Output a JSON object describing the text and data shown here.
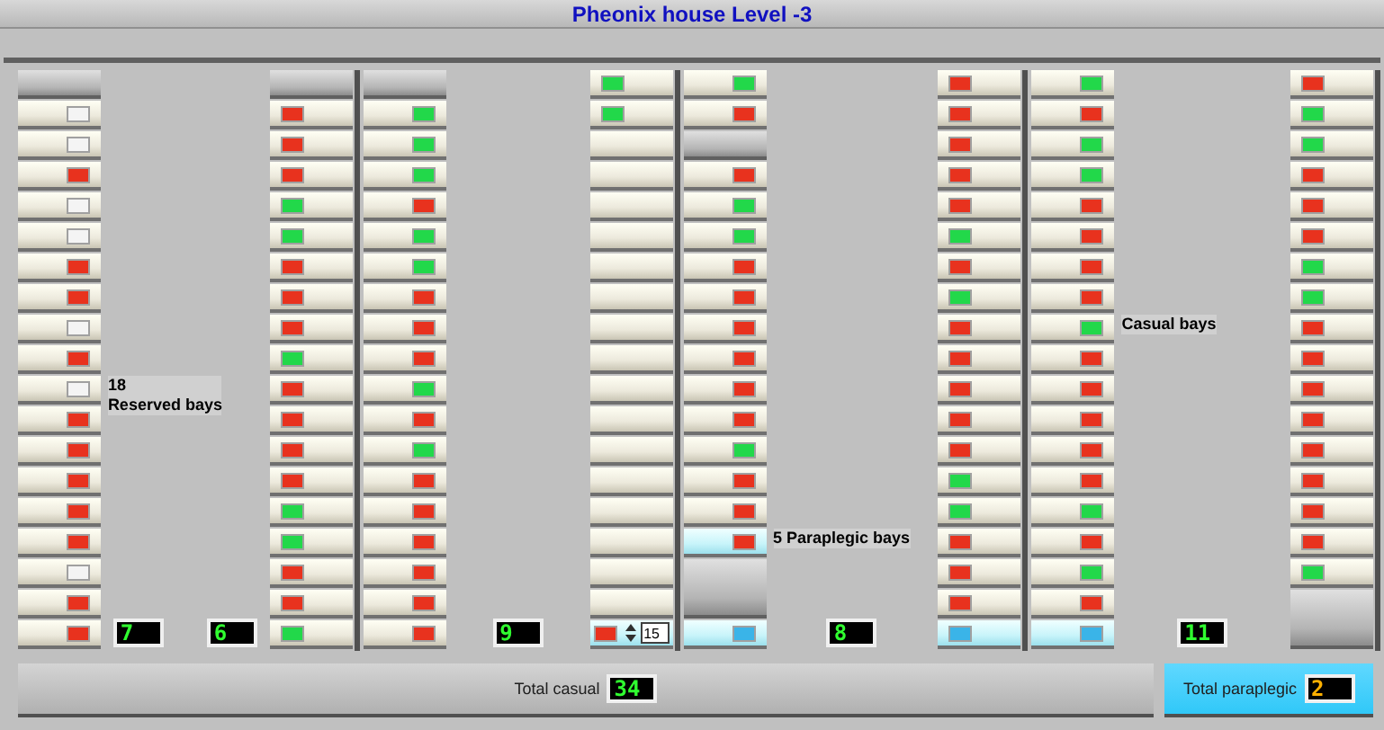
{
  "window": {
    "title": "Pheonix house Level -3"
  },
  "sections": [
    {
      "kind": "lane",
      "bays": [
        {
          "kind": "header"
        },
        {
          "kind": "bay",
          "color": "#f4f4f4"
        },
        {
          "kind": "bay",
          "color": "#f4f4f4"
        },
        {
          "kind": "bay",
          "color": "#e8321e"
        },
        {
          "kind": "bay",
          "color": "#f4f4f4"
        },
        {
          "kind": "bay",
          "color": "#f4f4f4"
        },
        {
          "kind": "bay",
          "color": "#e8321e"
        },
        {
          "kind": "bay",
          "color": "#e8321e"
        },
        {
          "kind": "bay",
          "color": "#f4f4f4"
        },
        {
          "kind": "bay",
          "color": "#e8321e"
        },
        {
          "kind": "bay",
          "color": "#f4f4f4",
          "note": [
            "18",
            "Reserved bays"
          ]
        },
        {
          "kind": "bay",
          "color": "#e8321e"
        },
        {
          "kind": "bay",
          "color": "#e8321e"
        },
        {
          "kind": "bay",
          "color": "#e8321e"
        },
        {
          "kind": "bay",
          "color": "#e8321e"
        },
        {
          "kind": "bay",
          "color": "#e8321e"
        },
        {
          "kind": "bay",
          "color": "#f4f4f4"
        },
        {
          "kind": "bay",
          "color": "#e8321e"
        },
        {
          "kind": "bay",
          "color": "#e8321e"
        }
      ]
    },
    {
      "kind": "gap",
      "counters": [
        "7",
        "6"
      ]
    },
    {
      "kind": "lane",
      "bays": [
        {
          "kind": "header"
        },
        {
          "kind": "bay",
          "color": "#e8321e"
        },
        {
          "kind": "bay",
          "color": "#e8321e"
        },
        {
          "kind": "bay",
          "color": "#e8321e"
        },
        {
          "kind": "bay",
          "color": "#22d84a"
        },
        {
          "kind": "bay",
          "color": "#22d84a"
        },
        {
          "kind": "bay",
          "color": "#e8321e"
        },
        {
          "kind": "bay",
          "color": "#e8321e"
        },
        {
          "kind": "bay",
          "color": "#e8321e"
        },
        {
          "kind": "bay",
          "color": "#22d84a"
        },
        {
          "kind": "bay",
          "color": "#e8321e"
        },
        {
          "kind": "bay",
          "color": "#e8321e"
        },
        {
          "kind": "bay",
          "color": "#e8321e"
        },
        {
          "kind": "bay",
          "color": "#e8321e"
        },
        {
          "kind": "bay",
          "color": "#22d84a"
        },
        {
          "kind": "bay",
          "color": "#22d84a"
        },
        {
          "kind": "bay",
          "color": "#e8321e"
        },
        {
          "kind": "bay",
          "color": "#e8321e"
        },
        {
          "kind": "bay",
          "color": "#22d84a"
        }
      ]
    },
    {
      "kind": "divider"
    },
    {
      "kind": "lane",
      "bays": [
        {
          "kind": "header"
        },
        {
          "kind": "bay",
          "color": "#22d84a"
        },
        {
          "kind": "bay",
          "color": "#22d84a"
        },
        {
          "kind": "bay",
          "color": "#22d84a"
        },
        {
          "kind": "bay",
          "color": "#e8321e"
        },
        {
          "kind": "bay",
          "color": "#22d84a"
        },
        {
          "kind": "bay",
          "color": "#22d84a"
        },
        {
          "kind": "bay",
          "color": "#e8321e"
        },
        {
          "kind": "bay",
          "color": "#e8321e"
        },
        {
          "kind": "bay",
          "color": "#e8321e"
        },
        {
          "kind": "bay",
          "color": "#22d84a"
        },
        {
          "kind": "bay",
          "color": "#e8321e"
        },
        {
          "kind": "bay",
          "color": "#22d84a"
        },
        {
          "kind": "bay",
          "color": "#e8321e"
        },
        {
          "kind": "bay",
          "color": "#e8321e"
        },
        {
          "kind": "bay",
          "color": "#e8321e"
        },
        {
          "kind": "bay",
          "color": "#e8321e"
        },
        {
          "kind": "bay",
          "color": "#e8321e"
        },
        {
          "kind": "bay",
          "color": "#e8321e"
        }
      ]
    },
    {
      "kind": "gap",
      "counters": [
        "9"
      ]
    },
    {
      "kind": "lane",
      "bays": [
        {
          "kind": "bay",
          "color": "#22d84a"
        },
        {
          "kind": "bay",
          "color": "#22d84a"
        },
        {
          "kind": "bay"
        },
        {
          "kind": "bay"
        },
        {
          "kind": "bay"
        },
        {
          "kind": "bay"
        },
        {
          "kind": "bay"
        },
        {
          "kind": "bay"
        },
        {
          "kind": "bay"
        },
        {
          "kind": "bay"
        },
        {
          "kind": "bay"
        },
        {
          "kind": "bay"
        },
        {
          "kind": "bay"
        },
        {
          "kind": "bay"
        },
        {
          "kind": "bay"
        },
        {
          "kind": "bay"
        },
        {
          "kind": "bay"
        },
        {
          "kind": "bay"
        },
        {
          "kind": "spinner",
          "color": "#e8321e",
          "value": "15",
          "accessible": true
        }
      ]
    },
    {
      "kind": "divider"
    },
    {
      "kind": "lane",
      "bays": [
        {
          "kind": "bay",
          "color": "#22d84a"
        },
        {
          "kind": "bay",
          "color": "#e8321e"
        },
        {
          "kind": "header"
        },
        {
          "kind": "bay",
          "color": "#e8321e"
        },
        {
          "kind": "bay",
          "color": "#22d84a"
        },
        {
          "kind": "bay",
          "color": "#22d84a"
        },
        {
          "kind": "bay",
          "color": "#e8321e"
        },
        {
          "kind": "bay",
          "color": "#e8321e"
        },
        {
          "kind": "bay",
          "color": "#e8321e"
        },
        {
          "kind": "bay",
          "color": "#e8321e"
        },
        {
          "kind": "bay",
          "color": "#e8321e"
        },
        {
          "kind": "bay",
          "color": "#e8321e"
        },
        {
          "kind": "bay",
          "color": "#22d84a"
        },
        {
          "kind": "bay",
          "color": "#e8321e"
        },
        {
          "kind": "bay",
          "color": "#e8321e"
        },
        {
          "kind": "bay",
          "color": "#e8321e",
          "accessible": true,
          "note": [
            "5 Paraplegic bays"
          ]
        },
        {
          "kind": "double"
        },
        {
          "kind": "bay",
          "color": "#3ab4e8",
          "accessible": true
        }
      ]
    },
    {
      "kind": "gap",
      "counters": [
        "8"
      ]
    },
    {
      "kind": "lane",
      "bays": [
        {
          "kind": "bay",
          "color": "#e8321e"
        },
        {
          "kind": "bay",
          "color": "#e8321e"
        },
        {
          "kind": "bay",
          "color": "#e8321e"
        },
        {
          "kind": "bay",
          "color": "#e8321e"
        },
        {
          "kind": "bay",
          "color": "#e8321e"
        },
        {
          "kind": "bay",
          "color": "#22d84a"
        },
        {
          "kind": "bay",
          "color": "#e8321e"
        },
        {
          "kind": "bay",
          "color": "#22d84a"
        },
        {
          "kind": "bay",
          "color": "#e8321e"
        },
        {
          "kind": "bay",
          "color": "#e8321e"
        },
        {
          "kind": "bay",
          "color": "#e8321e"
        },
        {
          "kind": "bay",
          "color": "#e8321e"
        },
        {
          "kind": "bay",
          "color": "#e8321e"
        },
        {
          "kind": "bay",
          "color": "#22d84a"
        },
        {
          "kind": "bay",
          "color": "#22d84a"
        },
        {
          "kind": "bay",
          "color": "#e8321e"
        },
        {
          "kind": "bay",
          "color": "#e8321e"
        },
        {
          "kind": "bay",
          "color": "#e8321e"
        },
        {
          "kind": "bay",
          "color": "#3ab4e8",
          "accessible": true
        }
      ]
    },
    {
      "kind": "divider"
    },
    {
      "kind": "lane",
      "bays": [
        {
          "kind": "bay",
          "color": "#22d84a"
        },
        {
          "kind": "bay",
          "color": "#e8321e"
        },
        {
          "kind": "bay",
          "color": "#22d84a"
        },
        {
          "kind": "bay",
          "color": "#22d84a"
        },
        {
          "kind": "bay",
          "color": "#e8321e"
        },
        {
          "kind": "bay",
          "color": "#e8321e"
        },
        {
          "kind": "bay",
          "color": "#e8321e"
        },
        {
          "kind": "bay",
          "color": "#e8321e"
        },
        {
          "kind": "bay",
          "color": "#22d84a",
          "note": [
            "Casual bays"
          ]
        },
        {
          "kind": "bay",
          "color": "#e8321e"
        },
        {
          "kind": "bay",
          "color": "#e8321e"
        },
        {
          "kind": "bay",
          "color": "#e8321e"
        },
        {
          "kind": "bay",
          "color": "#e8321e"
        },
        {
          "kind": "bay",
          "color": "#e8321e"
        },
        {
          "kind": "bay",
          "color": "#22d84a"
        },
        {
          "kind": "bay",
          "color": "#e8321e"
        },
        {
          "kind": "bay",
          "color": "#22d84a"
        },
        {
          "kind": "bay",
          "color": "#e8321e"
        },
        {
          "kind": "bay",
          "color": "#3ab4e8",
          "accessible": true
        }
      ]
    },
    {
      "kind": "gap",
      "counters": [
        "11"
      ]
    },
    {
      "kind": "lane",
      "bays": [
        {
          "kind": "bay",
          "color": "#e8321e"
        },
        {
          "kind": "bay",
          "color": "#22d84a"
        },
        {
          "kind": "bay",
          "color": "#22d84a"
        },
        {
          "kind": "bay",
          "color": "#e8321e"
        },
        {
          "kind": "bay",
          "color": "#e8321e"
        },
        {
          "kind": "bay",
          "color": "#e8321e"
        },
        {
          "kind": "bay",
          "color": "#22d84a"
        },
        {
          "kind": "bay",
          "color": "#22d84a"
        },
        {
          "kind": "bay",
          "color": "#e8321e"
        },
        {
          "kind": "bay",
          "color": "#e8321e"
        },
        {
          "kind": "bay",
          "color": "#e8321e"
        },
        {
          "kind": "bay",
          "color": "#e8321e"
        },
        {
          "kind": "bay",
          "color": "#e8321e"
        },
        {
          "kind": "bay",
          "color": "#e8321e"
        },
        {
          "kind": "bay",
          "color": "#e8321e"
        },
        {
          "kind": "bay",
          "color": "#e8321e"
        },
        {
          "kind": "bay",
          "color": "#22d84a"
        },
        {
          "kind": "double"
        }
      ]
    },
    {
      "kind": "divider"
    }
  ],
  "totals": [
    {
      "label": "Total casual",
      "value": "34",
      "accessible": false
    },
    {
      "label": "Total paraplegic",
      "value": "2",
      "accessible": true
    }
  ]
}
